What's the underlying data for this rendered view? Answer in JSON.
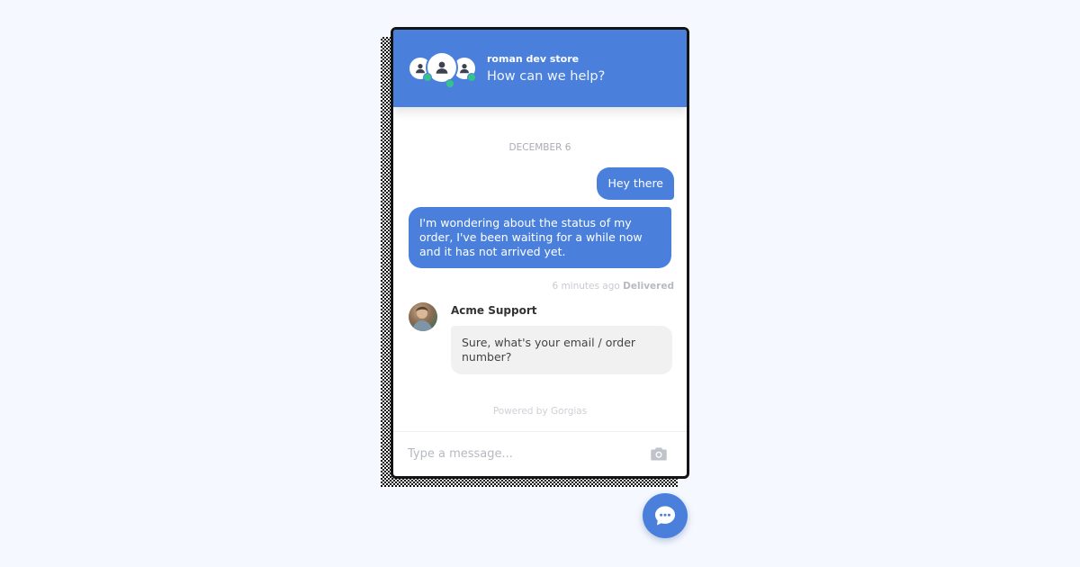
{
  "header": {
    "store_name": "roman dev store",
    "subtitle": "How can we help?"
  },
  "conversation": {
    "date_label": "DECEMBER 6",
    "user_messages": [
      {
        "text": "Hey there"
      },
      {
        "text": "I'm wondering about the status of my order, I've been waiting for a while now and it has not arrived yet."
      }
    ],
    "message_time": "6 minutes ago",
    "message_status": "Delivered",
    "agent": {
      "name": "Acme Support",
      "message": "Sure, what's your email / order number?"
    }
  },
  "footer": {
    "powered_by": "Powered by Gorgias"
  },
  "composer": {
    "placeholder": "Type a message...",
    "value": ""
  },
  "icons": {
    "header_avatars": "user-icon",
    "online_indicator": "online-dot-icon",
    "attachment": "camera-icon",
    "launcher": "chat-bubble-icon"
  },
  "colors": {
    "brand": "#4a80dc",
    "online": "#35c28d",
    "agent_bubble": "#f1f1f2",
    "page_background": "#f5f9ff"
  }
}
